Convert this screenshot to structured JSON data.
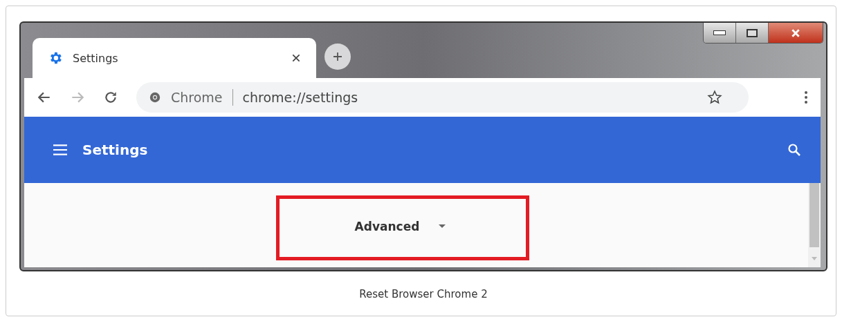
{
  "browser": {
    "tabs": [
      {
        "title": "Settings",
        "selected": true
      }
    ],
    "omnibox": {
      "site": "Chrome",
      "url": "chrome://settings"
    },
    "header": {
      "title": "Settings"
    },
    "content": {
      "button": "Advanced"
    }
  },
  "caption": "Reset Browser Chrome 2"
}
